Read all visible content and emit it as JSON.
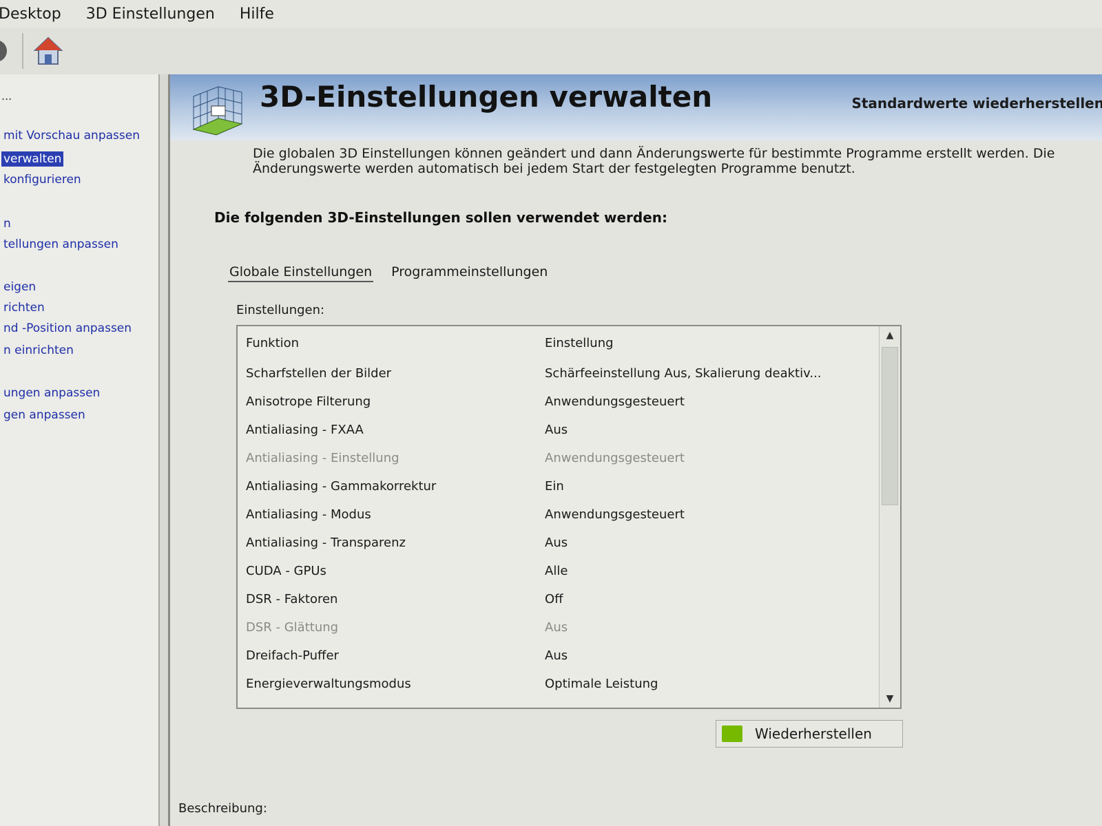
{
  "menubar": {
    "items": [
      "Desktop",
      "3D Einstellungen",
      "Hilfe"
    ]
  },
  "toolbar": {
    "icons": [
      "back-icon",
      "home-icon"
    ]
  },
  "sidebar": {
    "truncated_label": "...",
    "links": [
      {
        "label": "mit Vorschau anpassen"
      },
      {
        "label": "verwalten",
        "selected": true
      },
      {
        "label": "konfigurieren"
      },
      {
        "label": "n"
      },
      {
        "label": "tellungen anpassen"
      },
      {
        "label": "eigen"
      },
      {
        "label": "richten"
      },
      {
        "label": "nd -Position anpassen"
      },
      {
        "label": "n einrichten"
      },
      {
        "label": "ungen anpassen"
      },
      {
        "label": "gen anpassen"
      }
    ]
  },
  "main": {
    "title": "3D-Einstellungen verwalten",
    "restore_defaults": "Standardwerte wiederherstellen",
    "intro": "Die globalen 3D Einstellungen können geändert und dann Änderungswerte für bestimmte Programme erstellt werden. Die Änderungswerte werden automatisch bei jedem Start der festgelegten Programme benutzt.",
    "section_heading": "Die folgenden 3D-Einstellungen sollen verwendet werden:",
    "tabs": [
      {
        "label": "Globale Einstellungen",
        "active": true
      },
      {
        "label": "Programmeinstellungen",
        "active": false
      }
    ],
    "settings_label": "Einstellungen:",
    "table": {
      "headers": [
        "Funktion",
        "Einstellung"
      ],
      "rows": [
        {
          "feature": "Scharfstellen der Bilder",
          "value": "Schärfeeinstellung Aus, Skalierung deaktiv...",
          "disabled": false
        },
        {
          "feature": "Anisotrope Filterung",
          "value": "Anwendungsgesteuert",
          "disabled": false
        },
        {
          "feature": "Antialiasing - FXAA",
          "value": "Aus",
          "disabled": false
        },
        {
          "feature": "Antialiasing - Einstellung",
          "value": "Anwendungsgesteuert",
          "disabled": true
        },
        {
          "feature": "Antialiasing - Gammakorrektur",
          "value": "Ein",
          "disabled": false
        },
        {
          "feature": "Antialiasing - Modus",
          "value": "Anwendungsgesteuert",
          "disabled": false
        },
        {
          "feature": "Antialiasing - Transparenz",
          "value": "Aus",
          "disabled": false
        },
        {
          "feature": "CUDA - GPUs",
          "value": "Alle",
          "disabled": false
        },
        {
          "feature": "DSR - Faktoren",
          "value": "Off",
          "disabled": false
        },
        {
          "feature": "DSR - Glättung",
          "value": "Aus",
          "disabled": true
        },
        {
          "feature": "Dreifach-Puffer",
          "value": "Aus",
          "disabled": false
        },
        {
          "feature": "Energieverwaltungsmodus",
          "value": "Optimale Leistung",
          "disabled": false
        }
      ]
    },
    "restore_button": "Wiederherstellen",
    "description_label": "Beschreibung:"
  },
  "colors": {
    "link": "#1e2fa8",
    "selected_bg": "#2b3fb3",
    "nvidia_green": "#76b900"
  }
}
